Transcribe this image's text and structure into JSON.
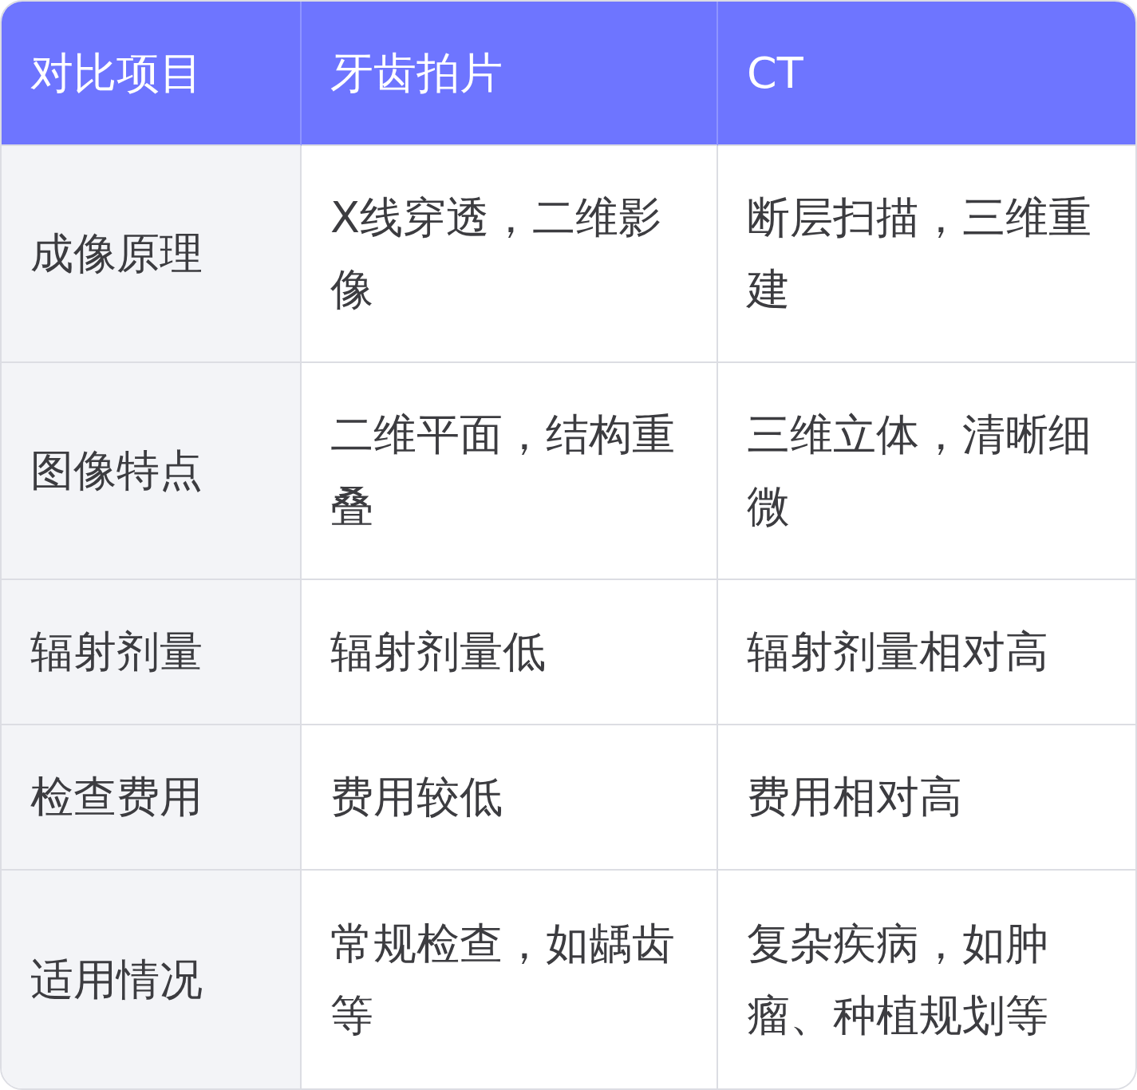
{
  "table": {
    "columns": [
      "对比项目",
      "牙齿拍片",
      "CT"
    ],
    "rows": [
      {
        "cells": [
          "成像原理",
          "X线穿透，二维影像",
          "断层扫描，三维重建"
        ]
      },
      {
        "cells": [
          "图像特点",
          "二维平面，结构重叠",
          "三维立体，清晰细微"
        ]
      },
      {
        "cells": [
          "辐射剂量",
          "辐射剂量低",
          "辐射剂量相对高"
        ]
      },
      {
        "cells": [
          "检查费用",
          "费用较低",
          "费用相对高"
        ]
      },
      {
        "cells": [
          "适用情况",
          "常规检查，如龋齿等",
          "复杂疾病，如肿瘤、种植规划等"
        ]
      }
    ]
  }
}
